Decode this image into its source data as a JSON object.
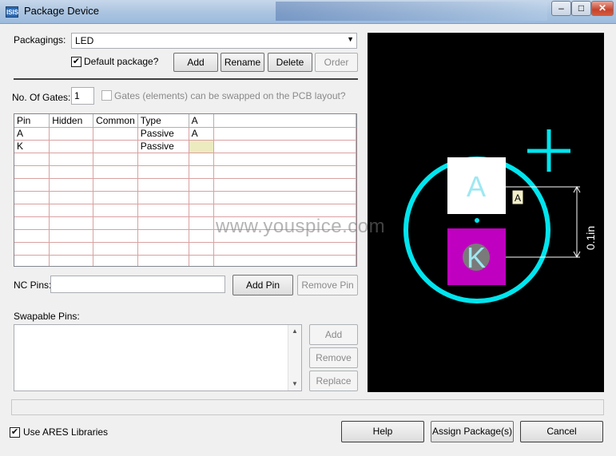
{
  "window": {
    "title": "Package Device",
    "icon_text": "ISIS",
    "minimize": "–",
    "maximize": "□",
    "close": "✕"
  },
  "packagings": {
    "label": "Packagings:",
    "value": "LED"
  },
  "default_package": {
    "label": "Default package?",
    "checked": true
  },
  "package_buttons": {
    "add": "Add",
    "rename": "Rename",
    "delete": "Delete",
    "order": "Order"
  },
  "gates": {
    "label": "No. Of Gates:",
    "value": "1",
    "swap_label": "Gates (elements) can be swapped on the PCB layout?"
  },
  "pin_table": {
    "columns": [
      "Pin",
      "Hidden",
      "Common",
      "Type",
      "A"
    ],
    "rows": [
      [
        "A",
        "",
        "",
        "Passive",
        "A"
      ],
      [
        "K",
        "",
        "",
        "Passive",
        ""
      ]
    ]
  },
  "nc_pins": {
    "label": "NC Pins:",
    "value": "",
    "add": "Add Pin",
    "remove": "Remove Pin"
  },
  "swapable": {
    "label": "Swapable Pins:",
    "add": "Add",
    "remove": "Remove",
    "replace": "Replace"
  },
  "preview": {
    "pad_a": "A",
    "pad_k": "K",
    "pin_label": "A",
    "dimension": "0.1in",
    "colors": {
      "outline": "#00e5ee",
      "pad_a": "#ffffff",
      "pad_k": "#c000c0",
      "background": "#000000"
    }
  },
  "watermark": "www.youspice.com",
  "use_ares": {
    "label": "Use ARES Libraries",
    "checked": true
  },
  "footer_buttons": {
    "help": "Help",
    "assign": "Assign Package(s)",
    "cancel": "Cancel"
  }
}
